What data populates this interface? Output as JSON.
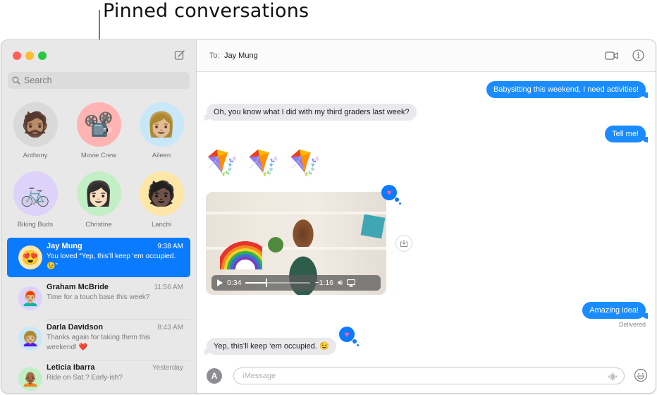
{
  "callout": {
    "label": "Pinned conversations"
  },
  "window": {
    "traffic_lights": [
      "close",
      "minimize",
      "zoom"
    ],
    "compose_icon": "compose-icon"
  },
  "sidebar": {
    "search": {
      "placeholder": "Search",
      "value": ""
    },
    "pinned": [
      {
        "name": "Anthony",
        "avatar": "🧔🏽",
        "bg": "#d9d9d9"
      },
      {
        "name": "Movie Crew",
        "avatar": "📽️",
        "bg": "#ffb3b3"
      },
      {
        "name": "Aileen",
        "avatar": "👩🏼",
        "bg": "#c8e8fa"
      },
      {
        "name": "Biking Buds",
        "avatar": "🚲",
        "bg": "#dcd2fa"
      },
      {
        "name": "Christine",
        "avatar": "👩🏻",
        "bg": "#c3efc6"
      },
      {
        "name": "Lanchi",
        "avatar": "🧑🏿",
        "bg": "#fde6a6"
      }
    ],
    "conversations": [
      {
        "name": "Jay Mung",
        "time": "9:38 AM",
        "preview": "You loved “Yep, this’ll keep ‘em occupied. 😉”",
        "avatar": "😍",
        "bg": "#fde6a6",
        "selected": true
      },
      {
        "name": "Graham McBride",
        "time": "11:56 AM",
        "preview": "Time for a touch base this week?",
        "avatar": "👨🏼‍🦰",
        "bg": "#dcd2fa",
        "selected": false
      },
      {
        "name": "Darla Davidson",
        "time": "8:43 AM",
        "preview": "Thanks again for taking them this weekend! ❤️",
        "avatar": "👩🏼‍🦱",
        "bg": "#c8e8fa",
        "selected": false
      },
      {
        "name": "Leticia Ibarra",
        "time": "Yesterday",
        "preview": "Ride on Sat.? Early-ish?",
        "avatar": "🧑🏾‍🦲",
        "bg": "#c3efc6",
        "selected": false
      }
    ]
  },
  "header": {
    "to_label": "To:",
    "recipient": "Jay Mung",
    "icons": [
      "video-camera-icon",
      "info-icon"
    ]
  },
  "messages": [
    {
      "direction": "out",
      "text": "Babysitting this weekend, I need activities!"
    },
    {
      "direction": "in",
      "text": "Oh, you know what I did with my third graders last week?"
    },
    {
      "direction": "out",
      "text": "Tell me!"
    },
    {
      "direction": "in",
      "type": "emoji",
      "text": "🪁 🪁 🪁"
    },
    {
      "direction": "in",
      "type": "video",
      "tapback": "heart",
      "elapsed": "0:34",
      "remaining": "−1:16",
      "progress": 0.31
    },
    {
      "direction": "out",
      "text": "Amazing idea!",
      "status": "Delivered"
    },
    {
      "direction": "in",
      "text": "Yep, this’ll keep ‘em occupied. 😉",
      "tapback": "heart"
    }
  ],
  "composer": {
    "placeholder": "iMessage",
    "value": "",
    "apps_icon": "app-store-icon",
    "audio_icon": "waveform-icon",
    "emoji_icon": "emoji-icon"
  },
  "colors": {
    "accent": "#0a7aff",
    "bubble_out": "#1a8cff",
    "bubble_in": "#e9e9eb",
    "sidebar_bg": "#e8e8e8",
    "tapback_heart": "#ff5fa2"
  }
}
